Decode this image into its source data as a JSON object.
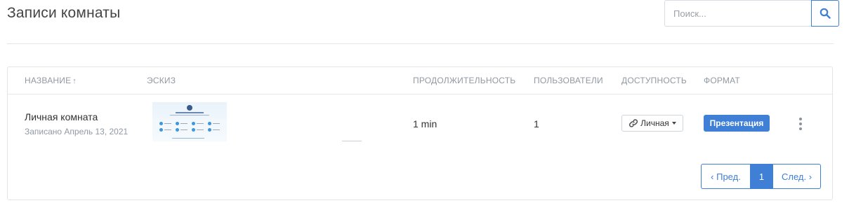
{
  "page": {
    "title": "Записи комнаты"
  },
  "search": {
    "placeholder": "Поиск..."
  },
  "table": {
    "headers": {
      "name": "НАЗВАНИЕ",
      "thumbnail": "ЭСКИЗ",
      "duration": "ПРОДОЛЖИТЕЛЬНОСТЬ",
      "users": "ПОЛЬЗОВАТЕЛИ",
      "visibility": "ДОСТУПНОСТЬ",
      "format": "ФОРМАТ"
    },
    "sort_indicator": "↑",
    "rows": [
      {
        "name": "Личная комната",
        "recorded": "Записано Апрель 13, 2021",
        "duration": "1 min",
        "users": "1",
        "visibility": "Личная",
        "format": "Презентация"
      }
    ]
  },
  "pagination": {
    "prev": "‹ Пред.",
    "current": "1",
    "next": "След. ›"
  },
  "colors": {
    "accent": "#3f7fd5",
    "muted": "#9099a3"
  },
  "icons": [
    "search-icon",
    "link-icon",
    "caret-down-icon",
    "kebab-menu-icon"
  ]
}
